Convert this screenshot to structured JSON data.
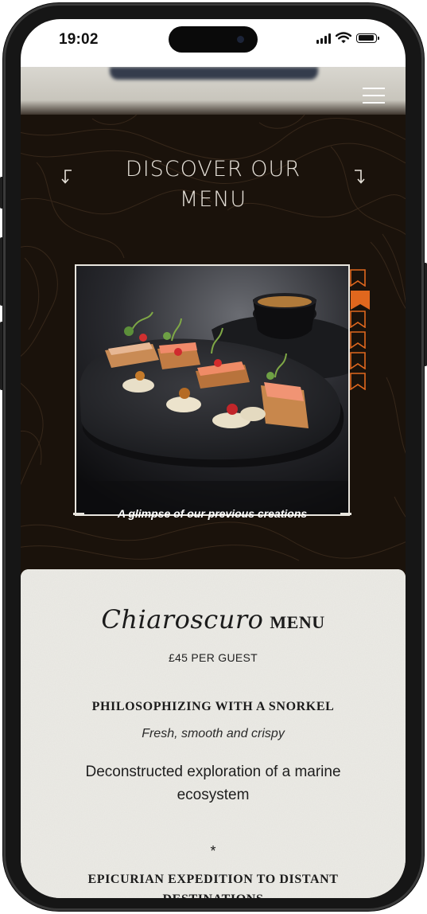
{
  "status_bar": {
    "time": "19:02"
  },
  "header": {
    "menu_icon": "hamburger-icon"
  },
  "hero": {
    "title_line1": "DISCOVER OUR",
    "title_line2": "MENU",
    "left_icon": "arrow-down-left-icon",
    "right_icon": "arrow-down-right-icon"
  },
  "gallery": {
    "caption": "A glimpse of our previous creations",
    "active_index": 1,
    "marker_count": 6,
    "marker_icon": "bookmark-icon",
    "accent_color": "#e0671e"
  },
  "menu": {
    "script_title": "Chiaroscuro",
    "title_word": "MENU",
    "price": "£45 PER GUEST",
    "courses": [
      {
        "title": "PHILOSOPHIZING WITH A SNORKEL",
        "subtitle": "Fresh, smooth and crispy",
        "description": "Deconstructed exploration of a marine ecosystem"
      },
      {
        "title": "EPICURIAN EXPEDITION TO DISTANT DESTINATIONS"
      }
    ],
    "divider": "*"
  },
  "colors": {
    "dark_bg": "#1a120b",
    "paper_bg": "#ecebe6",
    "accent": "#e0671e"
  }
}
